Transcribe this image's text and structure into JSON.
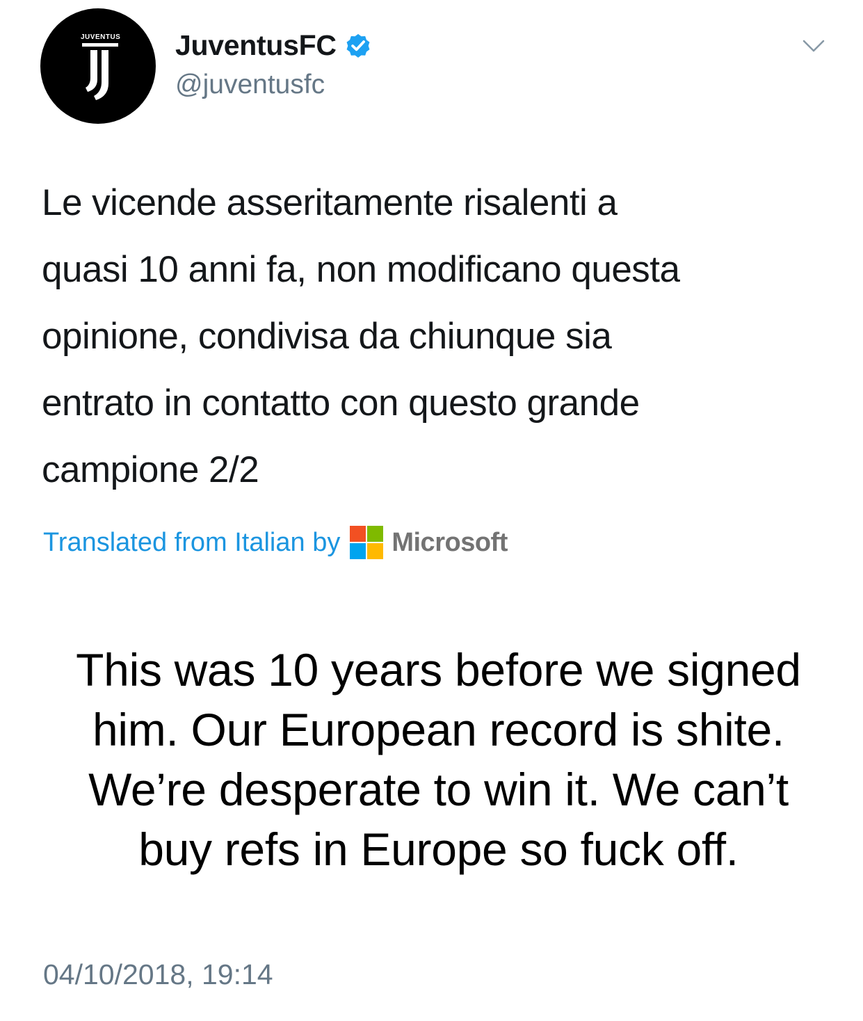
{
  "header": {
    "avatar_word": "JUVENTUS",
    "display_name": "JuventusFC",
    "verified_icon": "verified-badge-icon",
    "handle": "@juventusfc",
    "menu_icon": "chevron-down-icon"
  },
  "tweet": {
    "text": "Le vicende asseritamente risalenti a\nquasi 10 anni fa, non modificano questa\nopinione, condivisa da chiunque sia\nentrato in contatto con questo grande\ncampione 2/2",
    "translation_label": "Translated from Italian by",
    "translation_provider": "Microsoft",
    "timestamp": "04/10/2018, 19:14"
  },
  "caption": {
    "text": "This was 10 years before we signed\nhim. Our European record is shite.\nWe’re desperate to win it. We can’t\nbuy refs in Europe so fuck off."
  },
  "colors": {
    "link_blue": "#1b95e0",
    "secondary_gray": "#657786",
    "ms_red": "#f25022",
    "ms_green": "#7fba00",
    "ms_blue": "#00a4ef",
    "ms_yellow": "#ffb900"
  }
}
